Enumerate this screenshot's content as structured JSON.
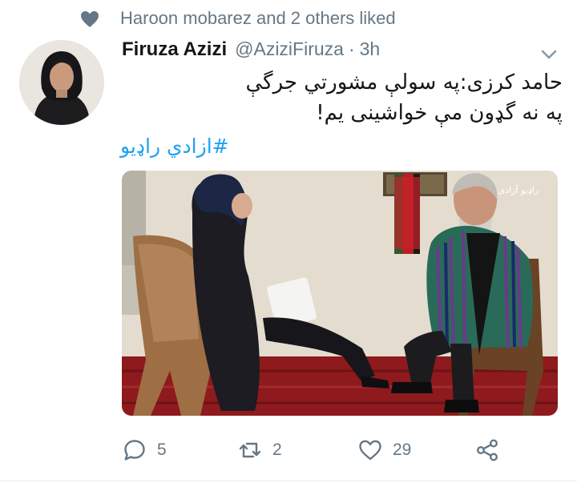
{
  "social_context": {
    "text": "Haroon mobarez and 2 others liked",
    "icon": "heart-icon"
  },
  "tweet": {
    "author_name": "Firuza Azizi",
    "author_handle": "@AziziFiruza",
    "separator": "·",
    "time": "3h",
    "text": "حامد کرزی:په سولې مشورتي جرگې په نه گډون مې خواشینی یم!",
    "hashtag": "#ازادي راډیو",
    "media": {
      "watermark": "راډیو آزادی",
      "description_icon": "interview-photo"
    }
  },
  "actions": {
    "reply_count": "5",
    "retweet_count": "2",
    "like_count": "29"
  },
  "colors": {
    "accent": "#1da1f2",
    "secondary_text": "#657786",
    "icon_gray": "#657786"
  }
}
